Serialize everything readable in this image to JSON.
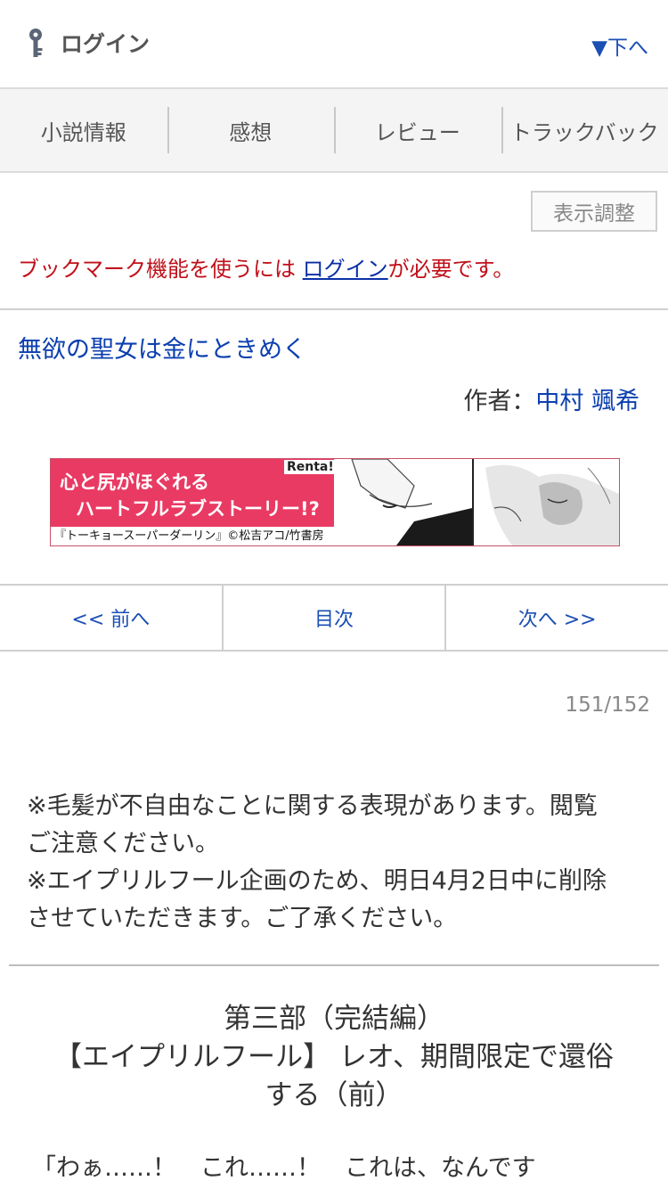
{
  "header": {
    "login_label": "ログイン",
    "down_label": "▼下へ"
  },
  "tabs": [
    {
      "label": "小説情報"
    },
    {
      "label": "感想"
    },
    {
      "label": "レビュー"
    },
    {
      "label": "トラックバック"
    }
  ],
  "display_adjust_label": "表示調整",
  "bookmark_notice": {
    "prefix": "ブックマーク機能を使うには ",
    "link": "ログイン",
    "suffix": "が必要です。"
  },
  "novel": {
    "title": "無欲の聖女は金にときめく",
    "author_prefix": "作者：",
    "author_name": "中村 颯希"
  },
  "banner": {
    "line1": "心と尻がほぐれる",
    "line2": "ハートフルラブストーリー!?",
    "credit": "『トーキョースーパーダーリン』©松吉アコ/竹書房",
    "badge": "Renta!"
  },
  "chapter_nav": {
    "prev": "<< 前へ",
    "toc": "目次",
    "next": "次へ >>"
  },
  "page_count": "151/152",
  "preface": [
    "※毛髪が不自由なことに関する表現があります。閲覧",
    "ご注意ください。",
    "※エイプリルフール企画のため、明日4月2日中に削除",
    "させていただきます。ご了承ください。"
  ],
  "chapter_heading": [
    "第三部（完結編）",
    "【エイプリルフール】 レオ、期間限定で還俗",
    "する（前）"
  ],
  "body_text": "「わぁ……！　これ……！　これは、なんです",
  "colors": {
    "link": "#0b3fb0",
    "notice": "#c0101a",
    "banner": "#e93a63"
  },
  "icons": {
    "login": "key-icon"
  }
}
